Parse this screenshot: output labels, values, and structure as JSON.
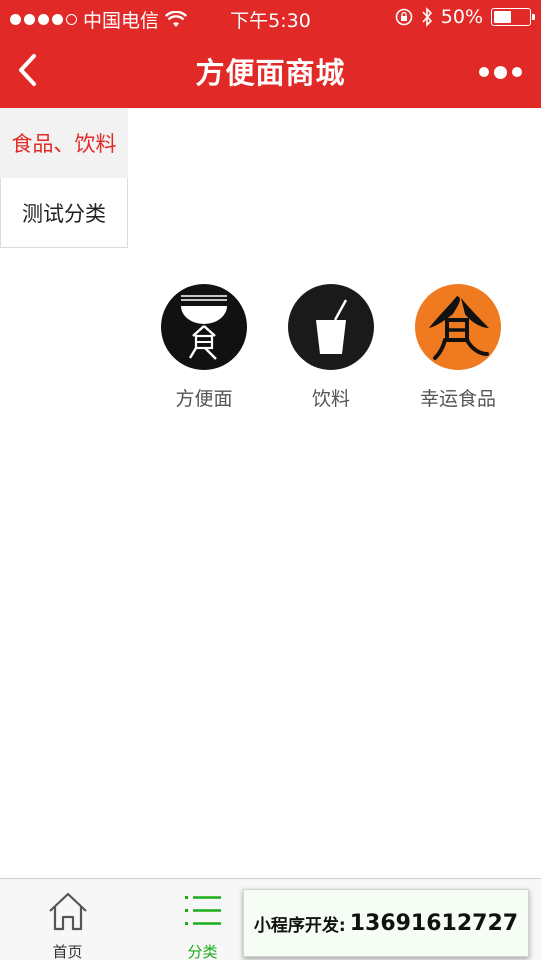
{
  "status_bar": {
    "carrier": "中国电信",
    "time": "下午5:30",
    "battery_text": "50%",
    "battery_level": 0.5
  },
  "nav": {
    "title": "方便面商城"
  },
  "sidebar": {
    "items": [
      {
        "label": "食品、饮料",
        "active": true
      },
      {
        "label": "测试分类",
        "active": false
      }
    ]
  },
  "products": [
    {
      "label": "方便面",
      "icon": "noodle-bowl-icon",
      "color": "#111111"
    },
    {
      "label": "饮料",
      "icon": "drink-cup-icon",
      "color": "#1a1a1a"
    },
    {
      "label": "幸运食品",
      "icon": "food-character-icon",
      "color": "#f07a1f"
    }
  ],
  "tabbar": {
    "items": [
      {
        "label": "首页",
        "icon": "home-icon"
      },
      {
        "label": "分类",
        "icon": "list-icon",
        "active": true
      }
    ]
  },
  "promo": {
    "label": "小程序开发:",
    "phone": "13691612727"
  },
  "colors": {
    "brand_red": "#e12a27",
    "active_green": "#1aad19"
  }
}
